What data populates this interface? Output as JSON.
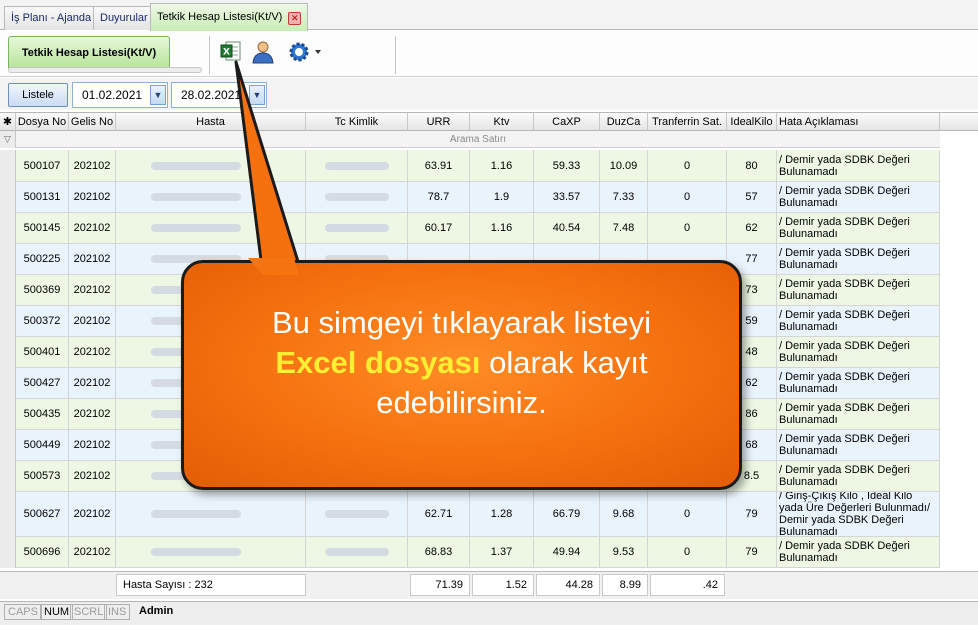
{
  "tabs": [
    {
      "label": "İş Planı - Ajanda"
    },
    {
      "label": "Duyurular"
    },
    {
      "label": "Tetkik Hesap Listesi(Kt/V)"
    }
  ],
  "form": {
    "tab_label": "Tetkik Hesap Listesi(Kt/V)"
  },
  "toolbar": {
    "icons": [
      "excel-export-icon",
      "user-icon",
      "gear-icon"
    ]
  },
  "filter": {
    "button_label": "Listele",
    "start_date": "01.02.2021",
    "end_date": "28.02.2021"
  },
  "grid": {
    "columns": [
      "Dosya No",
      "Gelis No",
      "Hasta",
      "Tc Kimlik",
      "URR",
      "Ktv",
      "CaXP",
      "DuzCa",
      "Tranferrin Sat.",
      "IdealKilo",
      "Hata Açıklaması"
    ],
    "search_row_label": "Arama Satırı",
    "rows": [
      {
        "dosya": "500107",
        "gelis": "202102",
        "urr": "63.91",
        "ktv": "1.16",
        "caxp": "59.33",
        "duzca": "10.09",
        "tsat": "0",
        "ideal": "80",
        "hata": "/ Demir yada SDBK Değeri Bulunamadı"
      },
      {
        "dosya": "500131",
        "gelis": "202102",
        "urr": "78.7",
        "ktv": "1.9",
        "caxp": "33.57",
        "duzca": "7.33",
        "tsat": "0",
        "ideal": "57",
        "hata": "/ Demir yada SDBK Değeri Bulunamadı"
      },
      {
        "dosya": "500145",
        "gelis": "202102",
        "urr": "60.17",
        "ktv": "1.16",
        "caxp": "40.54",
        "duzca": "7.48",
        "tsat": "0",
        "ideal": "62",
        "hata": "/ Demir yada SDBK Değeri Bulunamadı"
      },
      {
        "dosya": "500225",
        "gelis": "202102",
        "urr": "",
        "ktv": "",
        "caxp": "",
        "duzca": "",
        "tsat": "",
        "ideal": "77",
        "hata": "/ Demir yada SDBK Değeri Bulunamadı"
      },
      {
        "dosya": "500369",
        "gelis": "202102",
        "urr": "",
        "ktv": "",
        "caxp": "",
        "duzca": "",
        "tsat": "",
        "ideal": "73",
        "hata": "/ Demir yada SDBK Değeri Bulunamadı"
      },
      {
        "dosya": "500372",
        "gelis": "202102",
        "urr": "",
        "ktv": "",
        "caxp": "",
        "duzca": "",
        "tsat": "",
        "ideal": "59",
        "hata": "/ Demir yada SDBK Değeri Bulunamadı"
      },
      {
        "dosya": "500401",
        "gelis": "202102",
        "urr": "",
        "ktv": "",
        "caxp": "",
        "duzca": "",
        "tsat": "",
        "ideal": "48",
        "hata": "/ Demir yada SDBK Değeri Bulunamadı"
      },
      {
        "dosya": "500427",
        "gelis": "202102",
        "urr": "",
        "ktv": "",
        "caxp": "",
        "duzca": "",
        "tsat": "",
        "ideal": "62",
        "hata": "/ Demir yada SDBK Değeri Bulunamadı"
      },
      {
        "dosya": "500435",
        "gelis": "202102",
        "urr": "",
        "ktv": "",
        "caxp": "",
        "duzca": "",
        "tsat": "",
        "ideal": "86",
        "hata": "/ Demir yada SDBK Değeri Bulunamadı"
      },
      {
        "dosya": "500449",
        "gelis": "202102",
        "urr": "",
        "ktv": "",
        "caxp": "",
        "duzca": "",
        "tsat": "",
        "ideal": "68",
        "hata": "/ Demir yada SDBK Değeri Bulunamadı"
      },
      {
        "dosya": "500573",
        "gelis": "202102",
        "urr": "",
        "ktv": "",
        "caxp": "",
        "duzca": "",
        "tsat": "",
        "ideal": "8.5",
        "hata": "/ Demir yada SDBK Değeri Bulunamadı"
      },
      {
        "dosya": "500627",
        "gelis": "202102",
        "urr": "62.71",
        "ktv": "1.28",
        "caxp": "66.79",
        "duzca": "9.68",
        "tsat": "0",
        "ideal": "79",
        "hata": "/ Giriş-Çıkış Kilo , İdeal Kilo yada Üre Değerleri Bulunmadı/ Demir yada SDBK Değeri Bulunamadı"
      },
      {
        "dosya": "500696",
        "gelis": "202102",
        "urr": "68.83",
        "ktv": "1.37",
        "caxp": "49.94",
        "duzca": "9.53",
        "tsat": "0",
        "ideal": "79",
        "hata": "/ Demir yada SDBK Değeri Bulunamadı"
      }
    ]
  },
  "footer": {
    "hasta_sayisi": "Hasta Sayısı : 232",
    "urr": "71.39",
    "ktv": "1.52",
    "caxp": "44.28",
    "duzca": "8.99",
    "tsat": ".42"
  },
  "status": {
    "caps": "CAPS",
    "num": "NUM",
    "scrl": "SCRL",
    "ins": "INS",
    "user": "Admin"
  },
  "callout": {
    "line1": "Bu simgeyi tıklayarak listeyi",
    "highlight": "Excel dosyası",
    "line2_rest": " olarak kayıt",
    "line3": "edebilirsiniz."
  },
  "colors": {
    "row_green": "#eef7e4",
    "row_blue": "#e9f3fb",
    "callout_orange": "#f5700f",
    "callout_highlight": "#ffef33"
  }
}
